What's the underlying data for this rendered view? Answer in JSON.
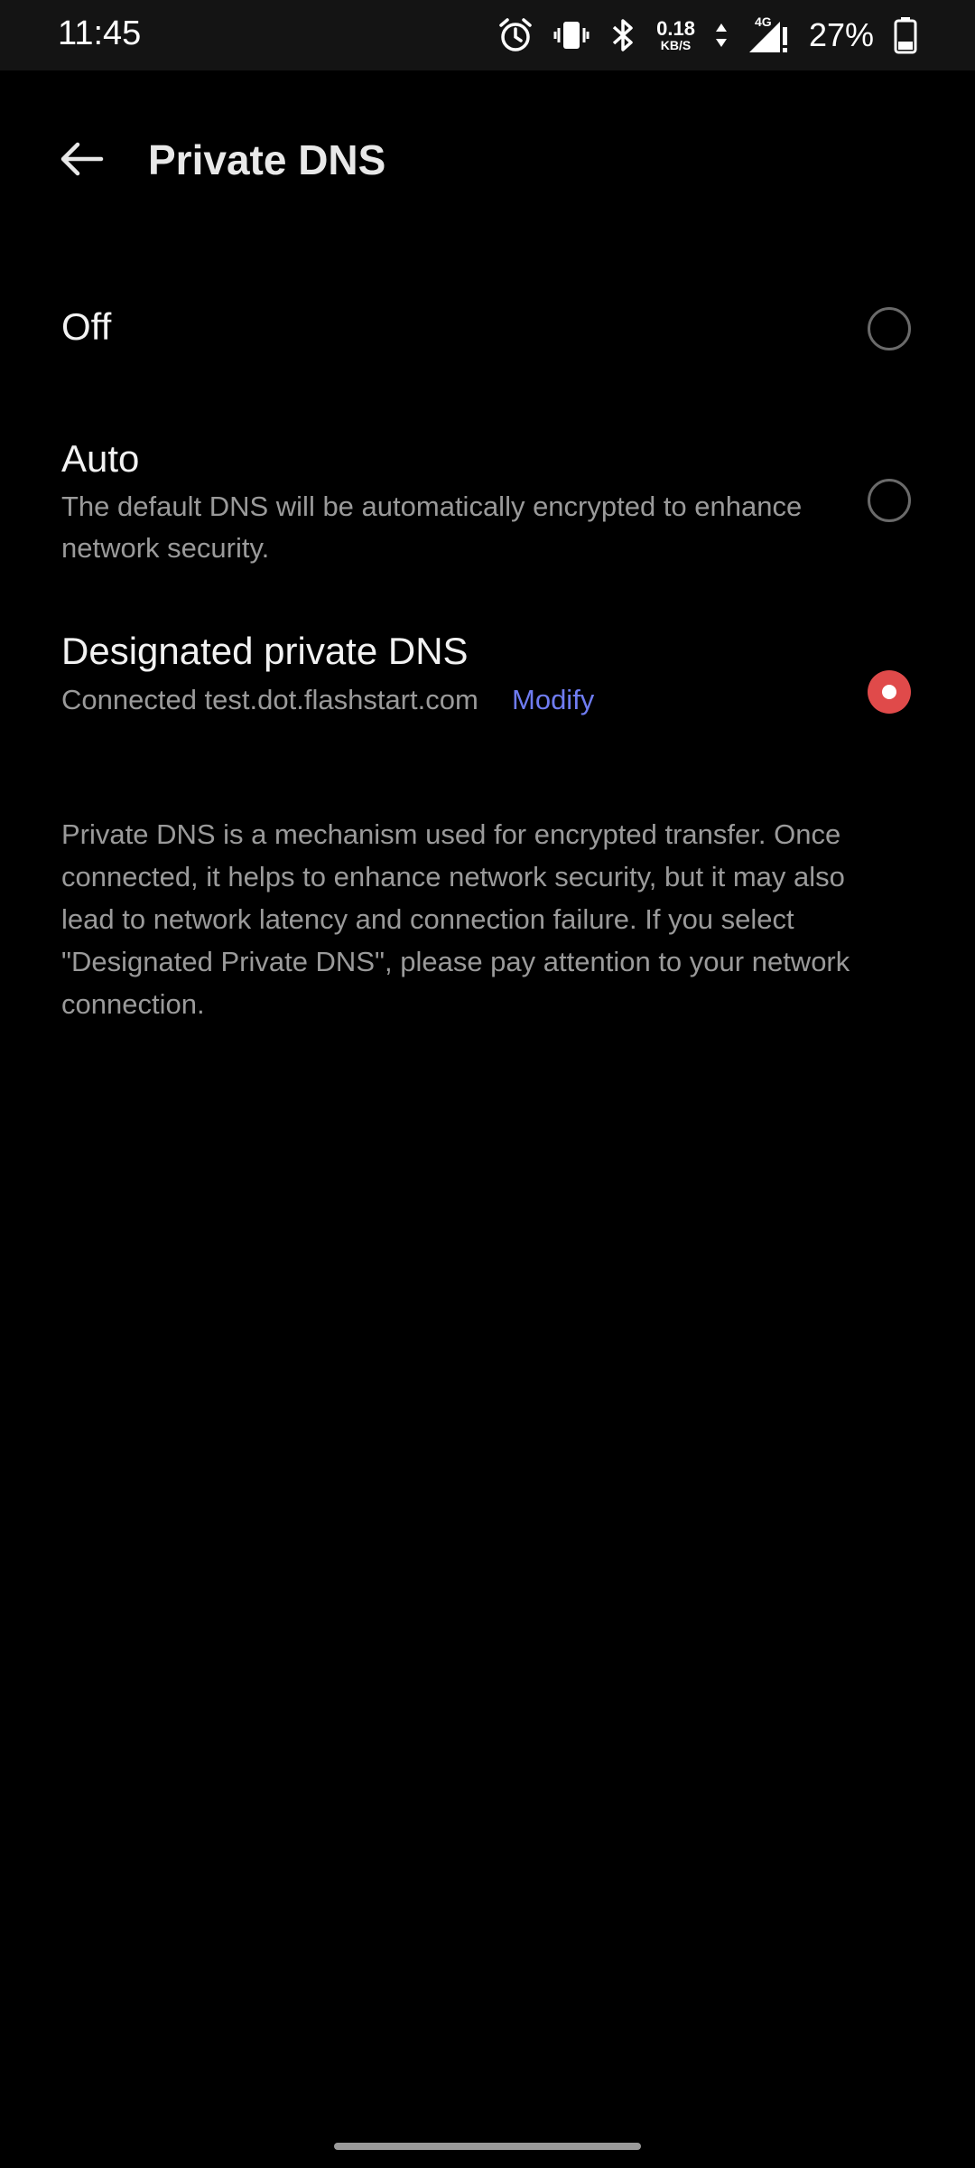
{
  "status_bar": {
    "time": "11:45",
    "net_speed_value": "0.18",
    "net_speed_unit": "KB/S",
    "network_type": "4G",
    "battery_percent": "27%",
    "icons": [
      "alarm-icon",
      "vibrate-icon",
      "bluetooth-icon",
      "data-arrows-icon",
      "signal-icon",
      "battery-icon"
    ]
  },
  "header": {
    "title": "Private DNS",
    "back_icon": "arrow-left-icon"
  },
  "options": [
    {
      "title": "Off",
      "selected": false
    },
    {
      "title": "Auto",
      "description": "The default DNS will be automatically encrypted to enhance network security.",
      "selected": false
    },
    {
      "title": "Designated private DNS",
      "status": "Connected test.dot.flashstart.com",
      "action": "Modify",
      "selected": true
    }
  ],
  "info": "Private DNS is a mechanism used for encrypted transfer. Once connected, it helps to enhance network security, but it may also lead to network latency and connection failure. If you select \"Designated Private DNS\", please pay attention to your network connection.",
  "colors": {
    "background": "#000000",
    "accent_selected": "#e04a4a",
    "link": "#6f7cf2",
    "secondary_text": "#9a9a9a"
  }
}
